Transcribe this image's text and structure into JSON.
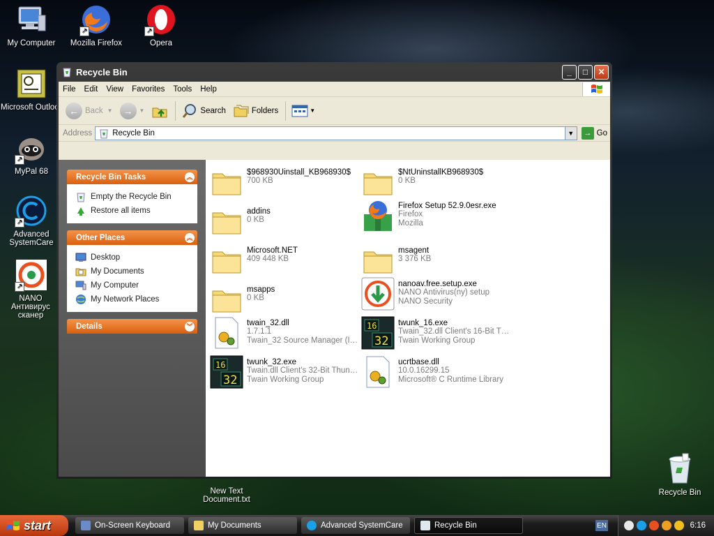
{
  "desktop": {
    "icons": [
      {
        "label": "My Computer"
      },
      {
        "label": "Mozilla Firefox"
      },
      {
        "label": "Opera"
      },
      {
        "label": "Microsoft Outlook"
      },
      {
        "label": "MyPal 68"
      },
      {
        "label": "Advanced SystemCare"
      },
      {
        "label": "NANO Антивирус сканер"
      },
      {
        "label": "New Text Document.txt"
      },
      {
        "label": "Recycle Bin"
      }
    ]
  },
  "window": {
    "title": "Recycle Bin",
    "menu": [
      "File",
      "Edit",
      "View",
      "Favorites",
      "Tools",
      "Help"
    ],
    "toolbar": {
      "back": "Back",
      "search": "Search",
      "folders": "Folders"
    },
    "address": {
      "label": "Address",
      "value": "Recycle Bin",
      "go": "Go"
    },
    "taskpane": {
      "tasks_title": "Recycle Bin Tasks",
      "tasks": [
        "Empty the Recycle Bin",
        "Restore all items"
      ],
      "places_title": "Other Places",
      "places": [
        "Desktop",
        "My Documents",
        "My Computer",
        "My Network Places"
      ],
      "details_title": "Details"
    },
    "files": [
      {
        "name": "$968930Uinstall_KB968930$",
        "line1": "700 KB",
        "line2": "",
        "icon": "folder-icon"
      },
      {
        "name": "$NtUninstallKB968930$",
        "line1": "0 KB",
        "line2": "",
        "icon": "folder-icon"
      },
      {
        "name": "addins",
        "line1": "0 KB",
        "line2": "",
        "icon": "folder-icon"
      },
      {
        "name": "Firefox Setup 52.9.0esr.exe",
        "line1": "Firefox",
        "line2": "Mozilla",
        "icon": "firefox-setup-icon"
      },
      {
        "name": "Microsoft.NET",
        "line1": "409 448 KB",
        "line2": "",
        "icon": "folder-icon"
      },
      {
        "name": "msagent",
        "line1": "3 376 KB",
        "line2": "",
        "icon": "folder-icon"
      },
      {
        "name": "msapps",
        "line1": "0 KB",
        "line2": "",
        "icon": "folder-icon"
      },
      {
        "name": "nanoav.free.setup.exe",
        "line1": "NANO Antivirus(ny) setup",
        "line2": "NANO Security",
        "icon": "nano-setup-icon"
      },
      {
        "name": "twain_32.dll",
        "line1": "1.7.1.1",
        "line2": "Twain_32 Source Manager (Im...",
        "icon": "dll-icon"
      },
      {
        "name": "twunk_16.exe",
        "line1": "Twain_32.dll Client's 16-Bit Th...",
        "line2": "Twain Working Group",
        "icon": "twunk16-icon"
      },
      {
        "name": "twunk_32.exe",
        "line1": "Twain.dll Client's 32-Bit Thunki...",
        "line2": "Twain Working Group",
        "icon": "twunk32-icon"
      },
      {
        "name": "ucrtbase.dll",
        "line1": "10.0.16299.15",
        "line2": "Microsoft® C Runtime Library",
        "icon": "dll-icon"
      }
    ]
  },
  "taskbar": {
    "start": "start",
    "tasks": [
      "On-Screen Keyboard",
      "My Documents",
      "Advanced SystemCare",
      "Recycle Bin"
    ],
    "lang": "EN",
    "clock": "6:16"
  }
}
